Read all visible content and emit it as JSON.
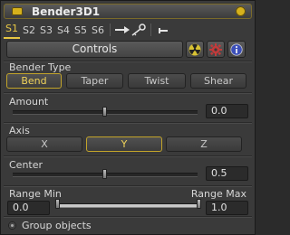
{
  "header": {
    "title": "Bender3D1"
  },
  "tabs": [
    {
      "label": "S1",
      "active": true
    },
    {
      "label": "S2",
      "active": false
    },
    {
      "label": "S3",
      "active": false
    },
    {
      "label": "S4",
      "active": false
    },
    {
      "label": "S5",
      "active": false
    },
    {
      "label": "S6",
      "active": false
    }
  ],
  "toolbar": {
    "controls_label": "Controls"
  },
  "bender_type": {
    "label": "Bender Type",
    "options": [
      "Bend",
      "Taper",
      "Twist",
      "Shear"
    ],
    "selected": "Bend"
  },
  "amount": {
    "label": "Amount",
    "value": "0.0",
    "level": 0.5
  },
  "axis": {
    "label": "Axis",
    "options": [
      "X",
      "Y",
      "Z"
    ],
    "selected": "Y"
  },
  "center": {
    "label": "Center",
    "value": "0.5",
    "level": 0.5
  },
  "range": {
    "min_label": "Range Min",
    "max_label": "Range Max",
    "min_value": "0.0",
    "max_value": "1.0"
  },
  "group_objects": {
    "label": "Group objects"
  },
  "colors": {
    "accent": "#e7c744",
    "panel": "#3a3a3a"
  }
}
